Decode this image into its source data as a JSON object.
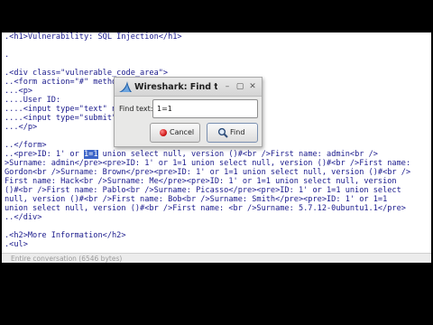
{
  "content": {
    "lines": [
      ".<h1>Vulnerability: SQL Injection</h1>",
      "",
      ".",
      "",
      ".<div class=\"vulnerable_code_area\">",
      "..<form action=\"#\" method=\"GET\">",
      "...<p>",
      "....User ID:",
      "....<input type=\"text\" name=\"id\">",
      "....<input type=\"submit\" name=\"Submit\" value=\"Submit\">",
      "...</p>",
      "",
      "..</form>",
      "..<pre>ID: 1' or |1=1| union select null, version ()#<br />First name: admin<br />",
      ">Surname: admin</pre><pre>ID: 1' or 1=1 union select null, version ()#<br />First name:",
      "Gordon<br />Surname: Brown</pre><pre>ID: 1' or 1=1 union select null, version ()#<br />",
      "First name: Hack<br />Surname: Me</pre><pre>ID: 1' or 1=1 union select null, version",
      "()#<br />First name: Pablo<br />Surname: Picasso</pre><pre>ID: 1' or 1=1 union select",
      "null, version ()#<br />First name: Bob<br />Surname: Smith</pre><pre>ID: 1' or 1=1",
      "union select null, version ()#<br />First name: <br />Surname: 5.7.12-0ubuntu1.1</pre>",
      "..</div>",
      "",
      ".<h2>More Information</h2>",
      ".<ul>"
    ],
    "highlight": "1=1"
  },
  "status": {
    "text": "Entire conversation (6546 bytes)"
  },
  "dialog": {
    "title": "Wireshark: Find text",
    "minimize_glyph": "–",
    "maximize_glyph": "▢",
    "close_glyph": "✕",
    "find_label": "Find text:",
    "find_value": "1=1",
    "cancel_label": "Cancel",
    "find_button_label": "Find",
    "icons": {
      "app": "wireshark-fin-icon",
      "cancel": "red-stop-icon",
      "find": "magnifier-icon"
    }
  },
  "colors": {
    "code_text": "#1a1a8c",
    "highlight_bg": "#3c64c8",
    "status_text": "#9a9a9a",
    "wireshark_blue": "#1f5fa8"
  }
}
